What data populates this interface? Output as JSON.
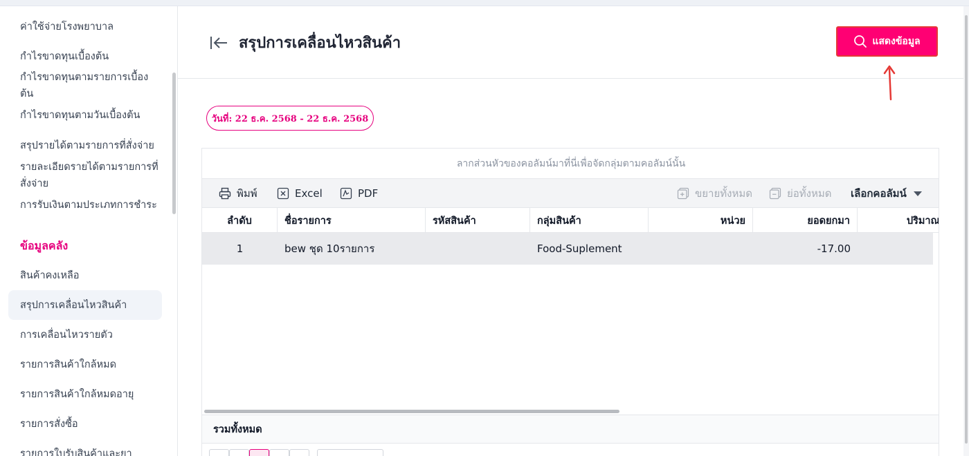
{
  "sidebar": {
    "items": [
      {
        "label": "ค่าใช้จ่ายโรงพยาบาล"
      },
      {
        "label": "กำไรขาดทุนเบื้องต้น"
      },
      {
        "label": "กำไรขาดทุนตามรายการเบื้องต้น"
      },
      {
        "label": "กำไรขาดทุนตามวันเบื้องต้น"
      },
      {
        "label": "สรุปรายได้ตามรายการที่สั่งจ่าย"
      },
      {
        "label": "รายละเอียดรายได้ตามรายการที่สั่งจ่าย"
      },
      {
        "label": "การรับเงินตามประเภทการชำระ"
      }
    ],
    "section_title": "ข้อมูลคลัง",
    "section_items": [
      {
        "label": "สินค้าคงเหลือ"
      },
      {
        "label": "สรุปการเคลื่อนไหวสินค้า"
      },
      {
        "label": "การเคลื่อนไหวรายตัว"
      },
      {
        "label": "รายการสินค้าใกล้หมด"
      },
      {
        "label": "รายการสินค้าใกล้หมดอายุ"
      },
      {
        "label": "รายการสั่งซื้อ"
      },
      {
        "label": "รายการใบรับสินค้าและยา"
      }
    ]
  },
  "header": {
    "title": "สรุปการเคลื่อนไหวสินค้า",
    "show_button": "แสดงข้อมูล"
  },
  "filter": {
    "date_range": "วันที่: 22 ธ.ค. 2568 - 22 ธ.ค. 2568"
  },
  "grid": {
    "group_panel_hint": "ลากส่วนหัวของคอลัมน์มาที่นี่เพื่อจัดกลุ่มตามคอลัมน์นั้น",
    "toolbar": {
      "print": "พิมพ์",
      "excel": "Excel",
      "pdf": "PDF",
      "expand_all": "ขยายทั้งหมด",
      "collapse_all": "ย่อทั้งหมด",
      "choose_columns": "เลือกคอลัมน์"
    },
    "columns": [
      "ลำดับ",
      "ชื่อรายการ",
      "รหัสสินค้า",
      "กลุ่มสินค้า",
      "หน่วย",
      "ยอดยกมา",
      "ปริมาณ"
    ],
    "rows": [
      {
        "no": "1",
        "name": "bew ชุด 10รายการ",
        "code": "",
        "group": "Food-Suplement",
        "unit": "",
        "carried": "-17.00",
        "qty": ""
      }
    ],
    "footer_total": "รวมทั้งหมด"
  },
  "colors": {
    "accent": "#e6007e",
    "button": "#ff0073",
    "annotation_arrow": "#e53935"
  }
}
